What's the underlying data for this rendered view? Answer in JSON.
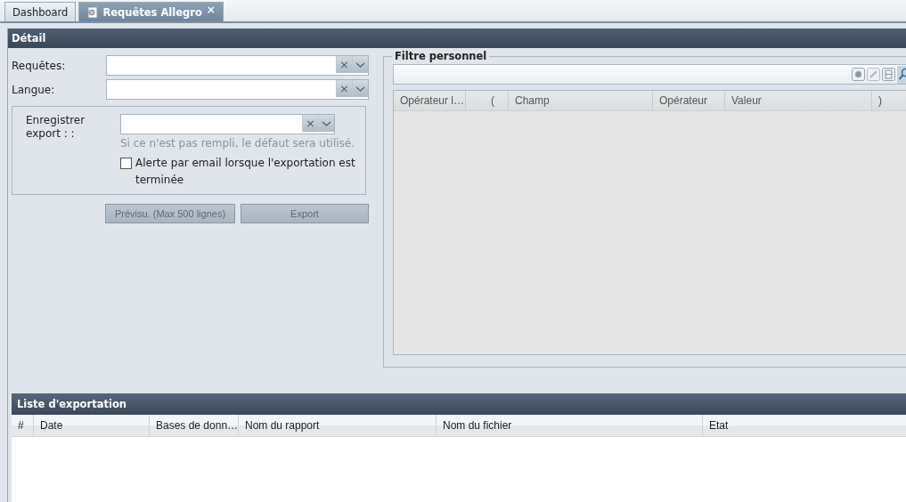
{
  "tabs": [
    {
      "label": "Dashboard",
      "selected": false
    },
    {
      "label": "Requêtes Allegro",
      "selected": true,
      "close": "×"
    }
  ],
  "detail": {
    "title": "Détail",
    "fields": [
      {
        "label": "Requêtes:",
        "clear": "×"
      },
      {
        "label": "Langue:",
        "clear": "×"
      }
    ],
    "export_group": {
      "label": "Enregistrer export : :",
      "clear": "×",
      "hint": "Si ce n'est pas rempli, le défaut sera utilisé.",
      "checkbox": {
        "label": "Alerte par email lorsque l'exportation est terminée",
        "checked": false
      }
    },
    "buttons": [
      {
        "label": "Prévisu. (Max 500 lignes)",
        "disabled": true
      },
      {
        "label": "Export",
        "disabled": true
      }
    ],
    "filter": {
      "title": "Filtre personnel",
      "columns": [
        "Opérateur l…",
        "(",
        "Champ",
        "Opérateur",
        "Valeur",
        ")"
      ]
    }
  },
  "export_list": {
    "title": "Liste d'exportation",
    "columns": [
      "#",
      "Date",
      "Bases de donn…",
      "Nom du rapport",
      "Nom du fichier",
      "Etat"
    ]
  }
}
